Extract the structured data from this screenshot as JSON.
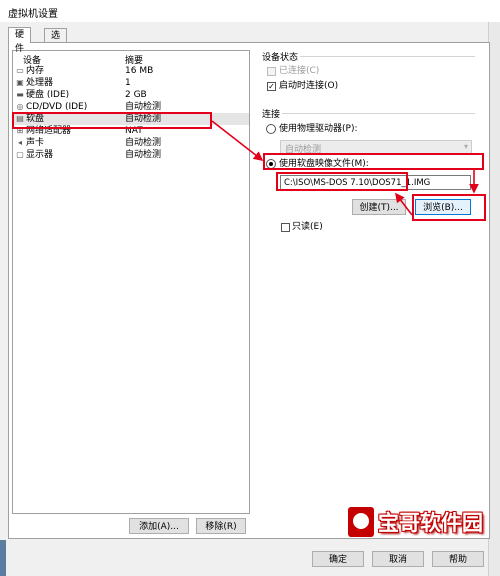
{
  "window": {
    "title": "虚拟机设置"
  },
  "tabs": [
    {
      "label": "硬件"
    },
    {
      "label": "选项"
    }
  ],
  "device_list": {
    "headers": {
      "device": "设备",
      "summary": "摘要"
    },
    "rows": [
      {
        "icon": "memory-icon",
        "name": "内存",
        "summary": "16 MB"
      },
      {
        "icon": "processor-icon",
        "name": "处理器",
        "summary": "1"
      },
      {
        "icon": "hard-disk-icon",
        "name": "硬盘 (IDE)",
        "summary": "2 GB"
      },
      {
        "icon": "cd-dvd-icon",
        "name": "CD/DVD (IDE)",
        "summary": "自动检测"
      },
      {
        "icon": "floppy-icon",
        "name": "软盘",
        "summary": "自动检测"
      },
      {
        "icon": "network-icon",
        "name": "网络适配器",
        "summary": "NAT"
      },
      {
        "icon": "sound-card-icon",
        "name": "声卡",
        "summary": "自动检测"
      },
      {
        "icon": "display-icon",
        "name": "显示器",
        "summary": "自动检测"
      }
    ],
    "selected_index": 4,
    "add_label": "添加(A)...",
    "remove_label": "移除(R)"
  },
  "device_status": {
    "title": "设备状态",
    "connected": {
      "label": "已连接(C)",
      "checked": false,
      "disabled": true
    },
    "connect_at_power_on": {
      "label": "启动时连接(O)",
      "checked": true
    }
  },
  "connection": {
    "title": "连接",
    "use_physical": {
      "label": "使用物理驱动器(P):",
      "checked": false
    },
    "physical_value": "自动检测",
    "use_image": {
      "label": "使用软盘映像文件(M):",
      "checked": true
    },
    "image_path": "C:\\ISO\\MS-DOS 7.10\\DOS71_1.IMG",
    "create_label": "创建(T)...",
    "browse_label": "浏览(B)...",
    "read_only": {
      "label": "只读(E)",
      "checked": false
    }
  },
  "footer": {
    "ok_label": "确定",
    "cancel_label": "取消",
    "help_label": "帮助"
  },
  "watermark": {
    "text": "宝哥软件园"
  },
  "colors": {
    "highlight": "#e3001b",
    "focus": "#0078d7",
    "watermark": "#c40000"
  }
}
